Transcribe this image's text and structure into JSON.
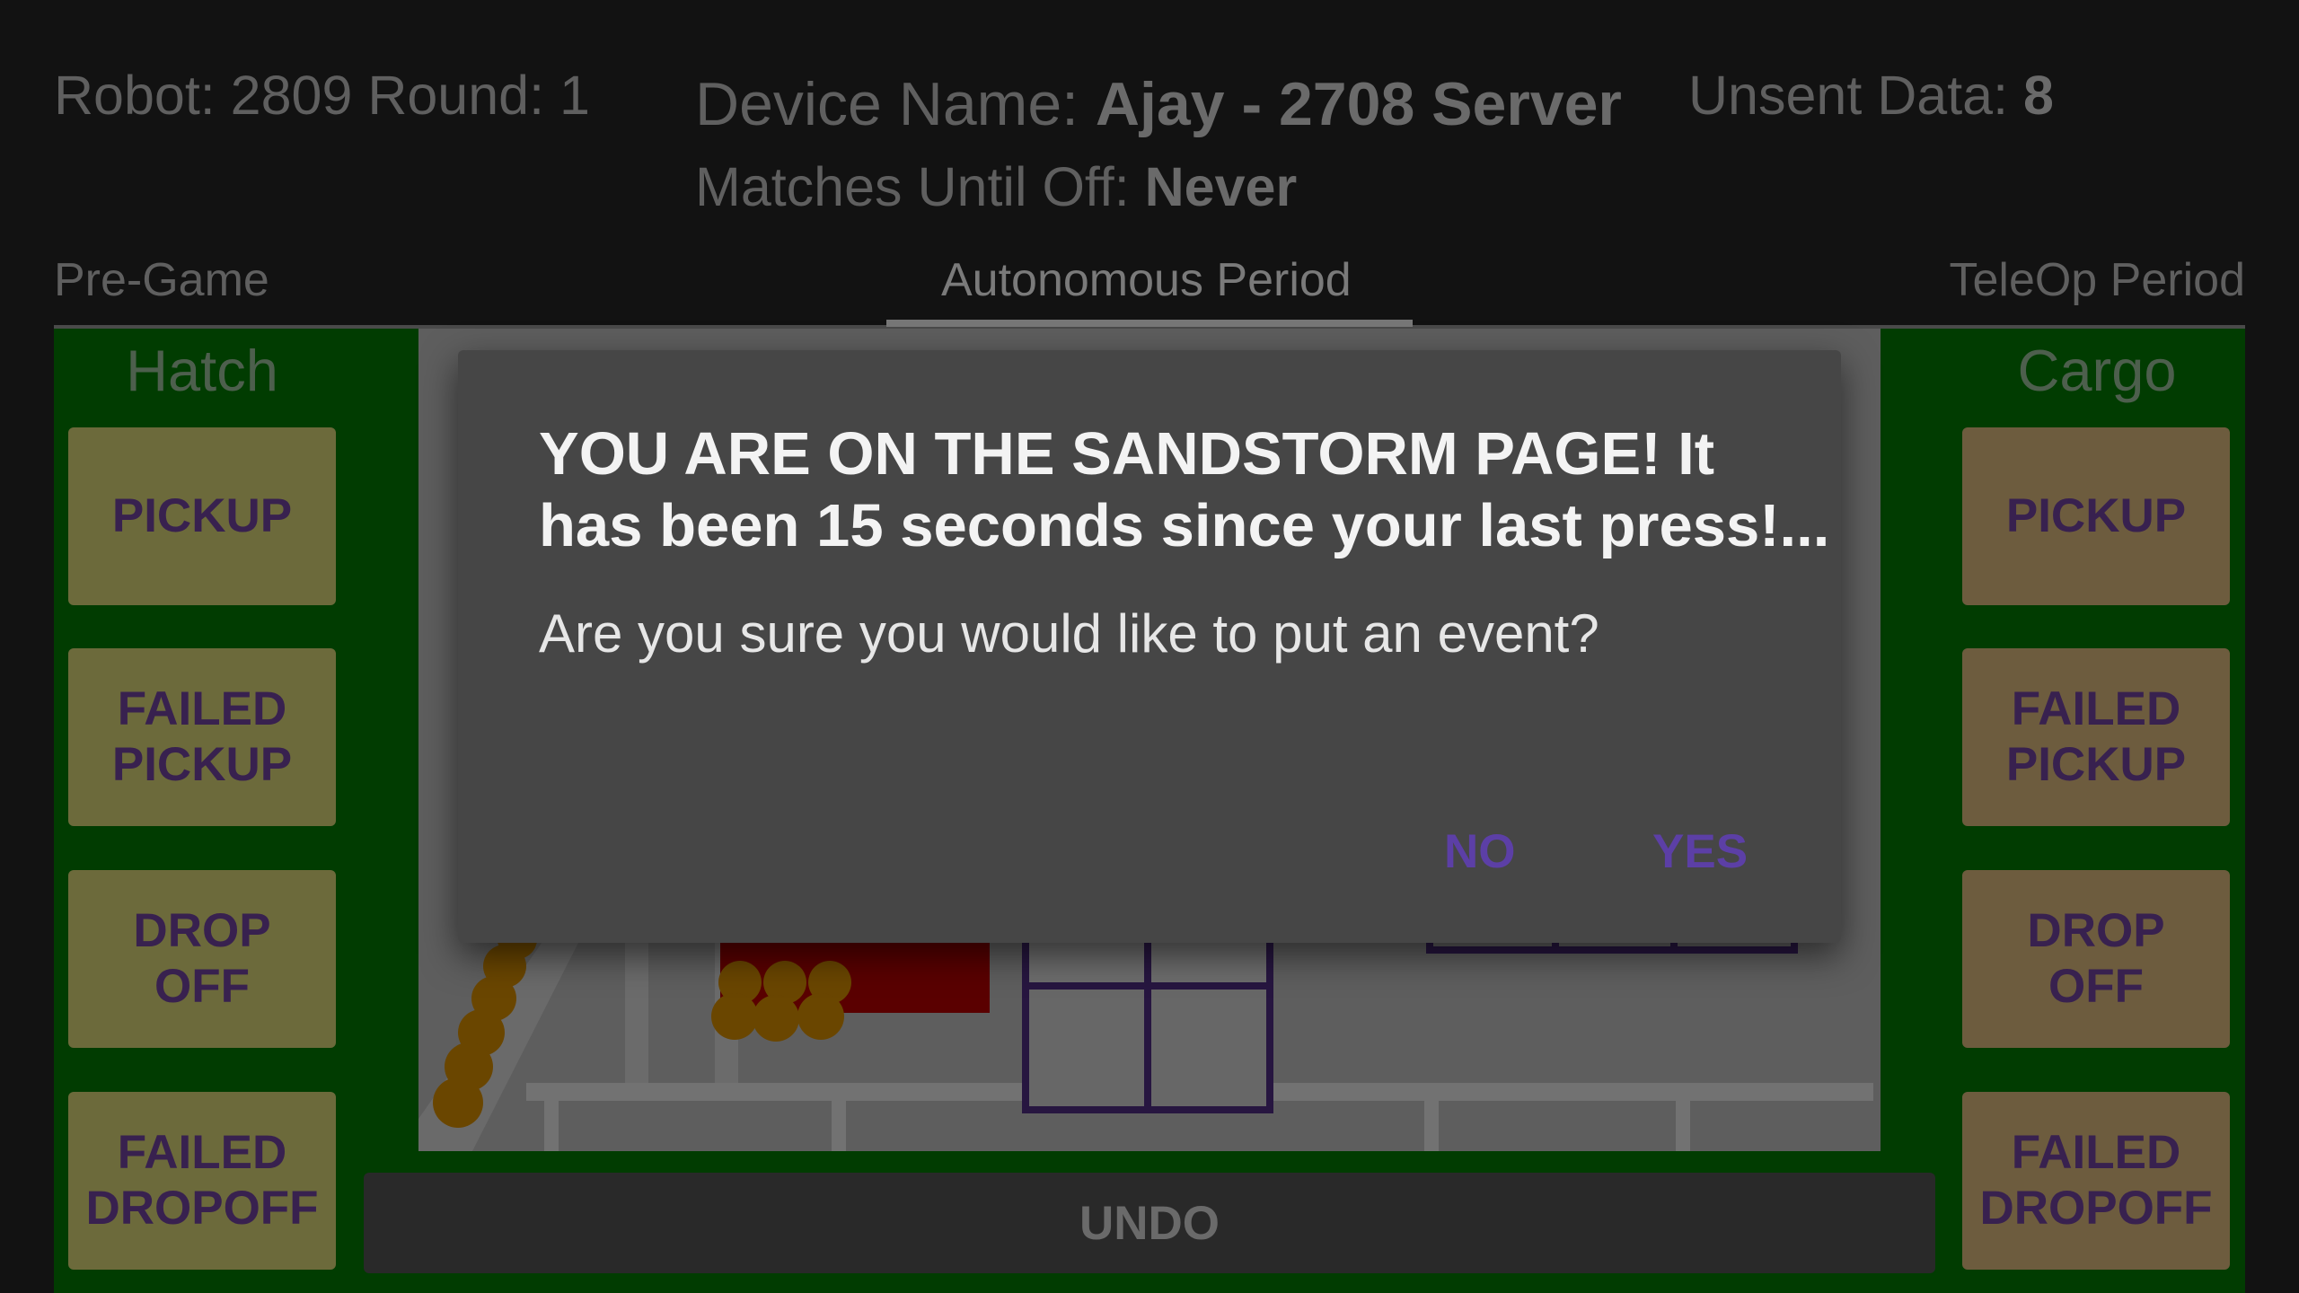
{
  "header": {
    "robot_label": "Robot: 2809 Round: 1",
    "device_name_label": "Device Name: ",
    "device_name_value": "Ajay - 2708 Server",
    "unsent_label": "Unsent Data: ",
    "unsent_value": "8",
    "matches_label": "Matches Until Off: ",
    "matches_value": "Never"
  },
  "tabs": [
    {
      "label": "Pre-Game"
    },
    {
      "label": "Autonomous Period"
    },
    {
      "label": "TeleOp Period"
    }
  ],
  "hatch": {
    "title": "Hatch",
    "buttons": [
      {
        "line1": "PICKUP",
        "line2": ""
      },
      {
        "line1": "FAILED",
        "line2": "PICKUP"
      },
      {
        "line1": "DROP",
        "line2": "OFF"
      },
      {
        "line1": "FAILED",
        "line2": "DROPOFF"
      }
    ]
  },
  "cargo": {
    "title": "Cargo",
    "buttons": [
      {
        "line1": "PICKUP",
        "line2": ""
      },
      {
        "line1": "FAILED",
        "line2": "PICKUP"
      },
      {
        "line1": "DROP",
        "line2": "OFF"
      },
      {
        "line1": "FAILED",
        "line2": "DROPOFF"
      }
    ]
  },
  "undo_label": "UNDO",
  "dialog": {
    "title_line1": "YOU ARE ON THE SANDSTORM PAGE! It",
    "title_line2": "has been 15 seconds since your last press!...",
    "message": "Are you sure you would like to put an event?",
    "no_label": "NO",
    "yes_label": "YES"
  },
  "colors": {
    "background": "#121212",
    "panel_green": "#013c01",
    "hatch_button": "#6c6a3b",
    "cargo_button": "#6d5c3e",
    "dialog_bg": "#464646",
    "dialog_action": "#5c3fa6"
  }
}
